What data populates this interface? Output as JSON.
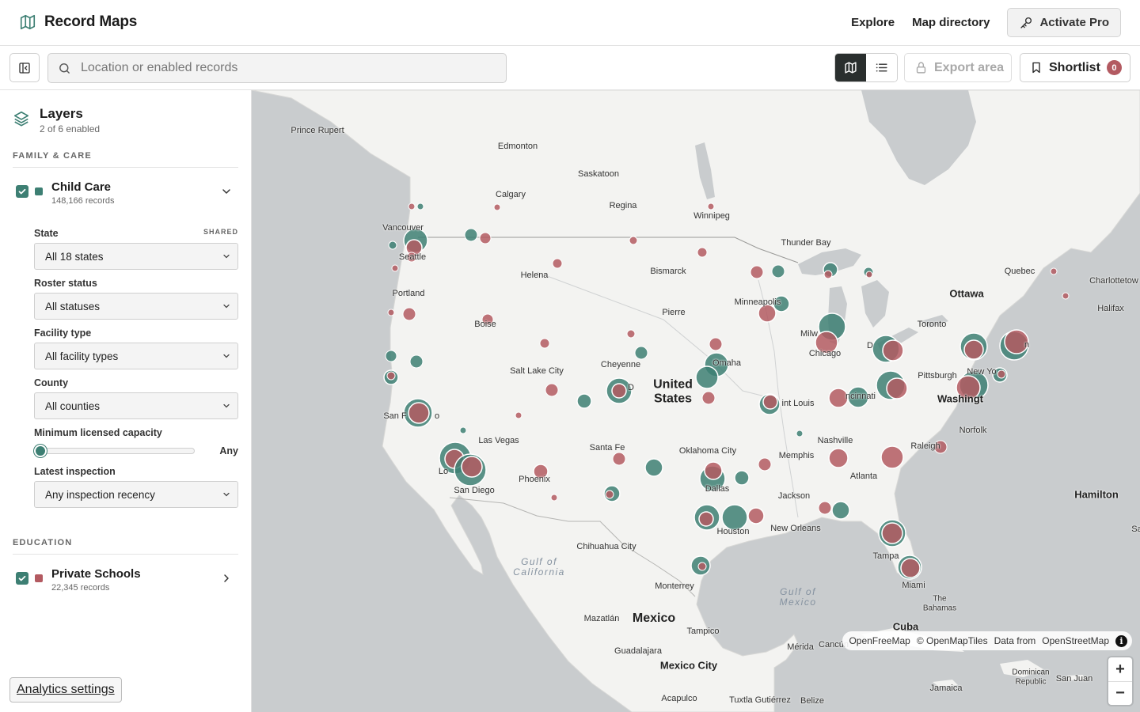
{
  "app": {
    "title": "Record Maps"
  },
  "topnav": {
    "explore": "Explore",
    "directory": "Map directory",
    "activate": "Activate Pro"
  },
  "toolbar": {
    "search_placeholder": "Location or enabled records",
    "export": "Export area",
    "shortlist": "Shortlist",
    "shortlist_count": "0",
    "view_mode": "map"
  },
  "sidebar": {
    "title": "Layers",
    "subtitle": "2 of 6 enabled",
    "sections": [
      {
        "label": "FAMILY & CARE",
        "layer": {
          "name": "Child Care",
          "count": "148,166 records",
          "checked": true,
          "color": "#3d7f73",
          "expanded": true
        },
        "filters": {
          "state": {
            "label": "State",
            "tag": "SHARED",
            "value": "All 18 states"
          },
          "roster": {
            "label": "Roster status",
            "value": "All statuses"
          },
          "facility": {
            "label": "Facility type",
            "value": "All facility types"
          },
          "county": {
            "label": "County",
            "value": "All counties"
          },
          "capacity": {
            "label": "Minimum licensed capacity",
            "value": "Any",
            "slider_fraction": 0
          },
          "inspection": {
            "label": "Latest inspection",
            "value": "Any inspection recency"
          }
        }
      },
      {
        "label": "EDUCATION",
        "layer": {
          "name": "Private Schools",
          "count": "22,345 records",
          "checked": true,
          "color": "#b35a61",
          "expanded": false
        }
      }
    ],
    "analytics": "Analytics settings"
  },
  "map": {
    "colors": {
      "water": "#c9ccce",
      "land": "#f3f3f1",
      "childcare": "#3d7f73",
      "schools": "#b35a61"
    },
    "labels": {
      "prince_rupert": "Prince Rupert",
      "edmonton": "Edmonton",
      "saskatoon": "Saskatoon",
      "calgary": "Calgary",
      "regina": "Regina",
      "winnipeg": "Winnipeg",
      "vancouver": "Vancouver",
      "seattle": "Seattle",
      "thunder_bay": "Thunder Bay",
      "helena": "Helena",
      "bismarck": "Bismarck",
      "quebec": "Quebec",
      "charlottetown": "Charlottetow",
      "ottawa": "Ottawa",
      "halifax": "Halifax",
      "portland": "Portland",
      "minneapolis": "Minneapolis",
      "toronto": "Toronto",
      "boise": "Boise",
      "pierre": "Pierre",
      "milwaukee": "Milw",
      "detroit": "D",
      "chicago": "Chicago",
      "new_york": "New Yo",
      "boston": "n",
      "omaha": "Omaha",
      "salt_lake": "Salt Lake City",
      "cheyenne": "Cheyenne",
      "pittsburgh": "Pittsburgh",
      "united_states": "United\nStates",
      "denver": "D",
      "washington": "Washingt",
      "cincinnati": "ncinnati",
      "san_francisco": "San F",
      "san_francisco_b": "o",
      "st_louis": "int Louis",
      "norfolk": "Norfolk",
      "las_vegas": "Las Vegas",
      "nashville": "Nashville",
      "santa_fe": "Santa Fe",
      "oklahoma_city": "Oklahoma City",
      "raleigh": "Raleigh",
      "memphis": "Memphis",
      "los_angeles": "Lo",
      "atlanta": "Atlanta",
      "hamilton": "Hamilton",
      "phoenix": "Phoenix",
      "san_diego": "San Diego",
      "dallas": "Dallas",
      "jackson": "Jackson",
      "houston": "Houston",
      "new_orleans": "New Orleans",
      "chihuahua": "Chihuahua City",
      "gulf_california": "Gulf of\nCalifornia",
      "tampa": "Tampa",
      "gulf_mexico": "Gulf of\nMexico",
      "monterrey": "Monterrey",
      "miami": "Miami",
      "bahamas": "The\nBahamas",
      "mexico": "Mexico",
      "mazatlan": "Mazatlán",
      "cuba": "Cuba",
      "tampico": "Tampico",
      "merida": "Mérida",
      "cancun": "Cancún",
      "guadalajara": "Guadalajara",
      "mexico_city": "Mexico City",
      "dominican": "Dominican\nRepublic",
      "san_juan": "San Juan",
      "jamaica": "Jamaica",
      "acapulco": "Acapulco",
      "tuxtla": "Tuxtla Gutiérrez",
      "belize": "Belize",
      "sa": "Sa"
    },
    "attribution": {
      "openfreemap": "OpenFreeMap",
      "omt": "© OpenMapTiles",
      "data_from": "Data from",
      "osm": "OpenStreetMap"
    },
    "zoom_in": "+",
    "zoom_out": "−"
  }
}
